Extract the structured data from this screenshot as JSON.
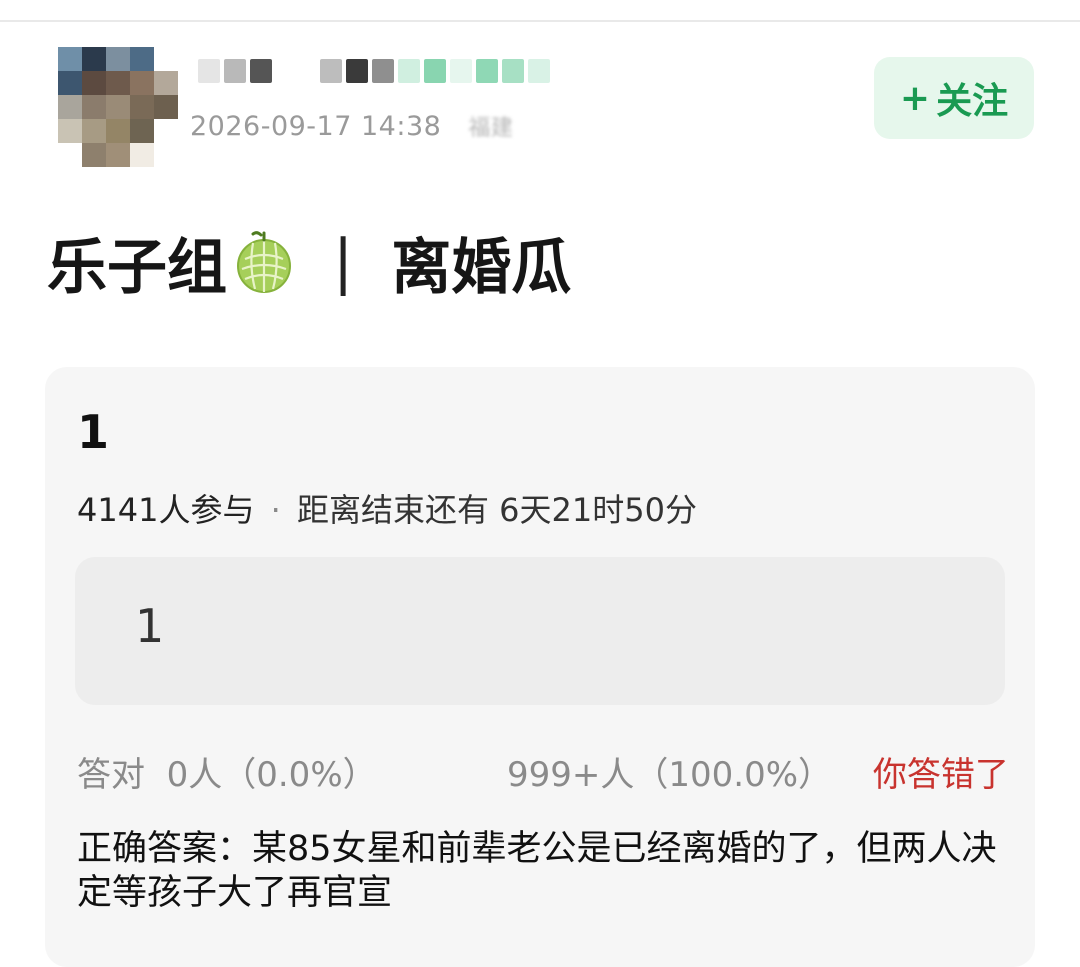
{
  "header": {
    "timestamp": "2026-09-17 14:38",
    "location": "福建",
    "follow_plus": "+",
    "follow_label": "关注"
  },
  "post": {
    "title_part1": "乐子组",
    "title_separator": "|",
    "title_part2": "离婚瓜",
    "emoji_icon": "melon-icon"
  },
  "poll": {
    "title": "1",
    "participants": "4141人参与",
    "separator": "·",
    "countdown": "距离结束还有 6天21时50分",
    "option_label": "1",
    "correct_stats": "答对  0人（0.0%）",
    "wrong_stats": "999+人（100.0%）",
    "wrong_label": "你答错了",
    "answer_text": "正确答案：某85女星和前辈老公是已经离婚的了，但两人决定等孩子大了再官宣"
  },
  "colors": {
    "accent_green": "#1a9a52",
    "follow_bg": "#e6f7ec",
    "wrong_red": "#c8332e",
    "card_bg": "#f6f6f6"
  }
}
